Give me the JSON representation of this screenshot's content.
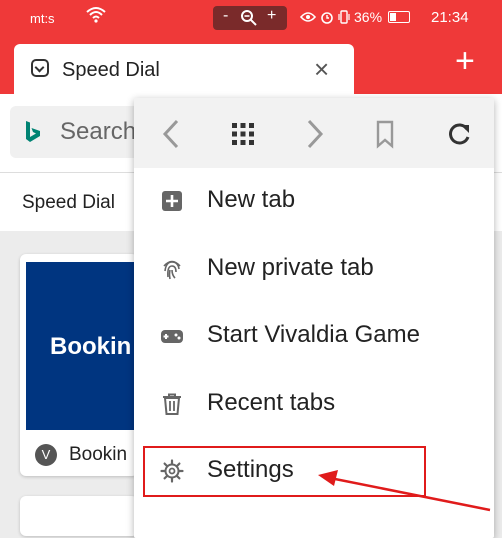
{
  "status_bar": {
    "carrier": "mt:s",
    "zoom_minus": "-",
    "zoom_plus": "+",
    "battery": "36%",
    "time": "21:34"
  },
  "tab": {
    "title": "Speed Dial",
    "close": "×",
    "add": "+"
  },
  "search": {
    "text": "Search"
  },
  "speed_dial": {
    "tab_label": "Speed Dial",
    "cards": [
      {
        "thumb_text": "Bookin",
        "favicon": "V",
        "label": "Bookin"
      }
    ]
  },
  "menu": {
    "nav": [
      "back-icon",
      "grid-icon",
      "forward-icon",
      "bookmark-icon",
      "reload-icon"
    ],
    "items": [
      {
        "label": "New tab",
        "icon": "plus-square-icon"
      },
      {
        "label": "New private tab",
        "icon": "fingerprint-icon"
      },
      {
        "label": "Start Vivaldia Game",
        "icon": "gamepad-icon"
      },
      {
        "label": "Recent tabs",
        "icon": "trash-icon"
      },
      {
        "label": "Settings",
        "icon": "gear-icon"
      }
    ]
  },
  "colors": {
    "accent": "#ef3939",
    "booking_blue": "#003580",
    "annotation": "#e01b1b"
  }
}
